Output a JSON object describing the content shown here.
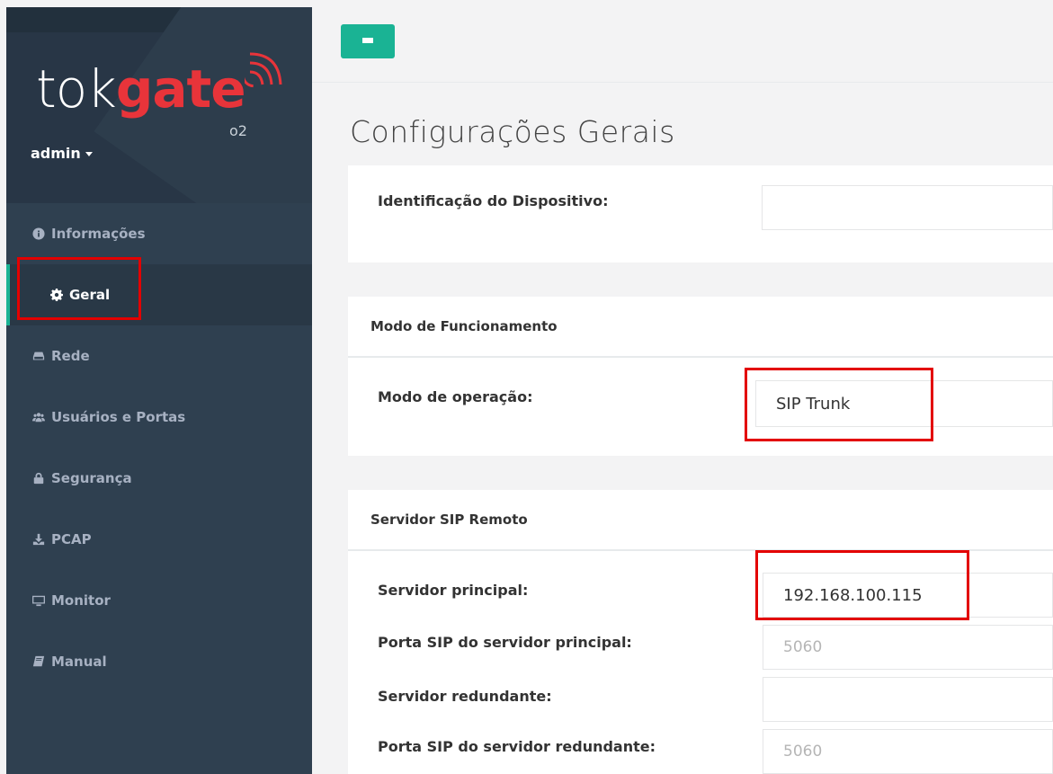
{
  "brand": {
    "logo_prefix": "tok",
    "logo_suffix": "gate",
    "logo_sub": "o2"
  },
  "user": {
    "name": "admin"
  },
  "nav": {
    "items": [
      {
        "label": "Informações",
        "icon": "info-icon"
      },
      {
        "label": "Geral",
        "icon": "gear-icon",
        "active": true
      },
      {
        "label": "Rede",
        "icon": "hdd-icon"
      },
      {
        "label": "Usuários e Portas",
        "icon": "users-icon"
      },
      {
        "label": "Segurança",
        "icon": "lock-icon"
      },
      {
        "label": "PCAP",
        "icon": "download-icon"
      },
      {
        "label": "Monitor",
        "icon": "monitor-icon"
      },
      {
        "label": "Manual",
        "icon": "book-icon"
      }
    ]
  },
  "page": {
    "title": "Configurações Gerais"
  },
  "device": {
    "label": "Identificação do Dispositivo:",
    "value": ""
  },
  "mode": {
    "section_title": "Modo de Funcionamento",
    "label": "Modo de operação:",
    "value": "SIP Trunk"
  },
  "sip": {
    "section_title": "Servidor SIP Remoto",
    "primary_label": "Servidor principal:",
    "primary_value": "192.168.100.115",
    "primary_port_label": "Porta SIP do servidor principal:",
    "primary_port_placeholder": "5060",
    "redundant_label": "Servidor redundante:",
    "redundant_value": "",
    "redundant_port_label": "Porta SIP do servidor redundante:",
    "redundant_port_placeholder": "5060"
  },
  "colors": {
    "accent": "#1ab394",
    "sidebar": "#2f4050",
    "highlight": "#e30000",
    "logo_red": "#e8343a"
  }
}
